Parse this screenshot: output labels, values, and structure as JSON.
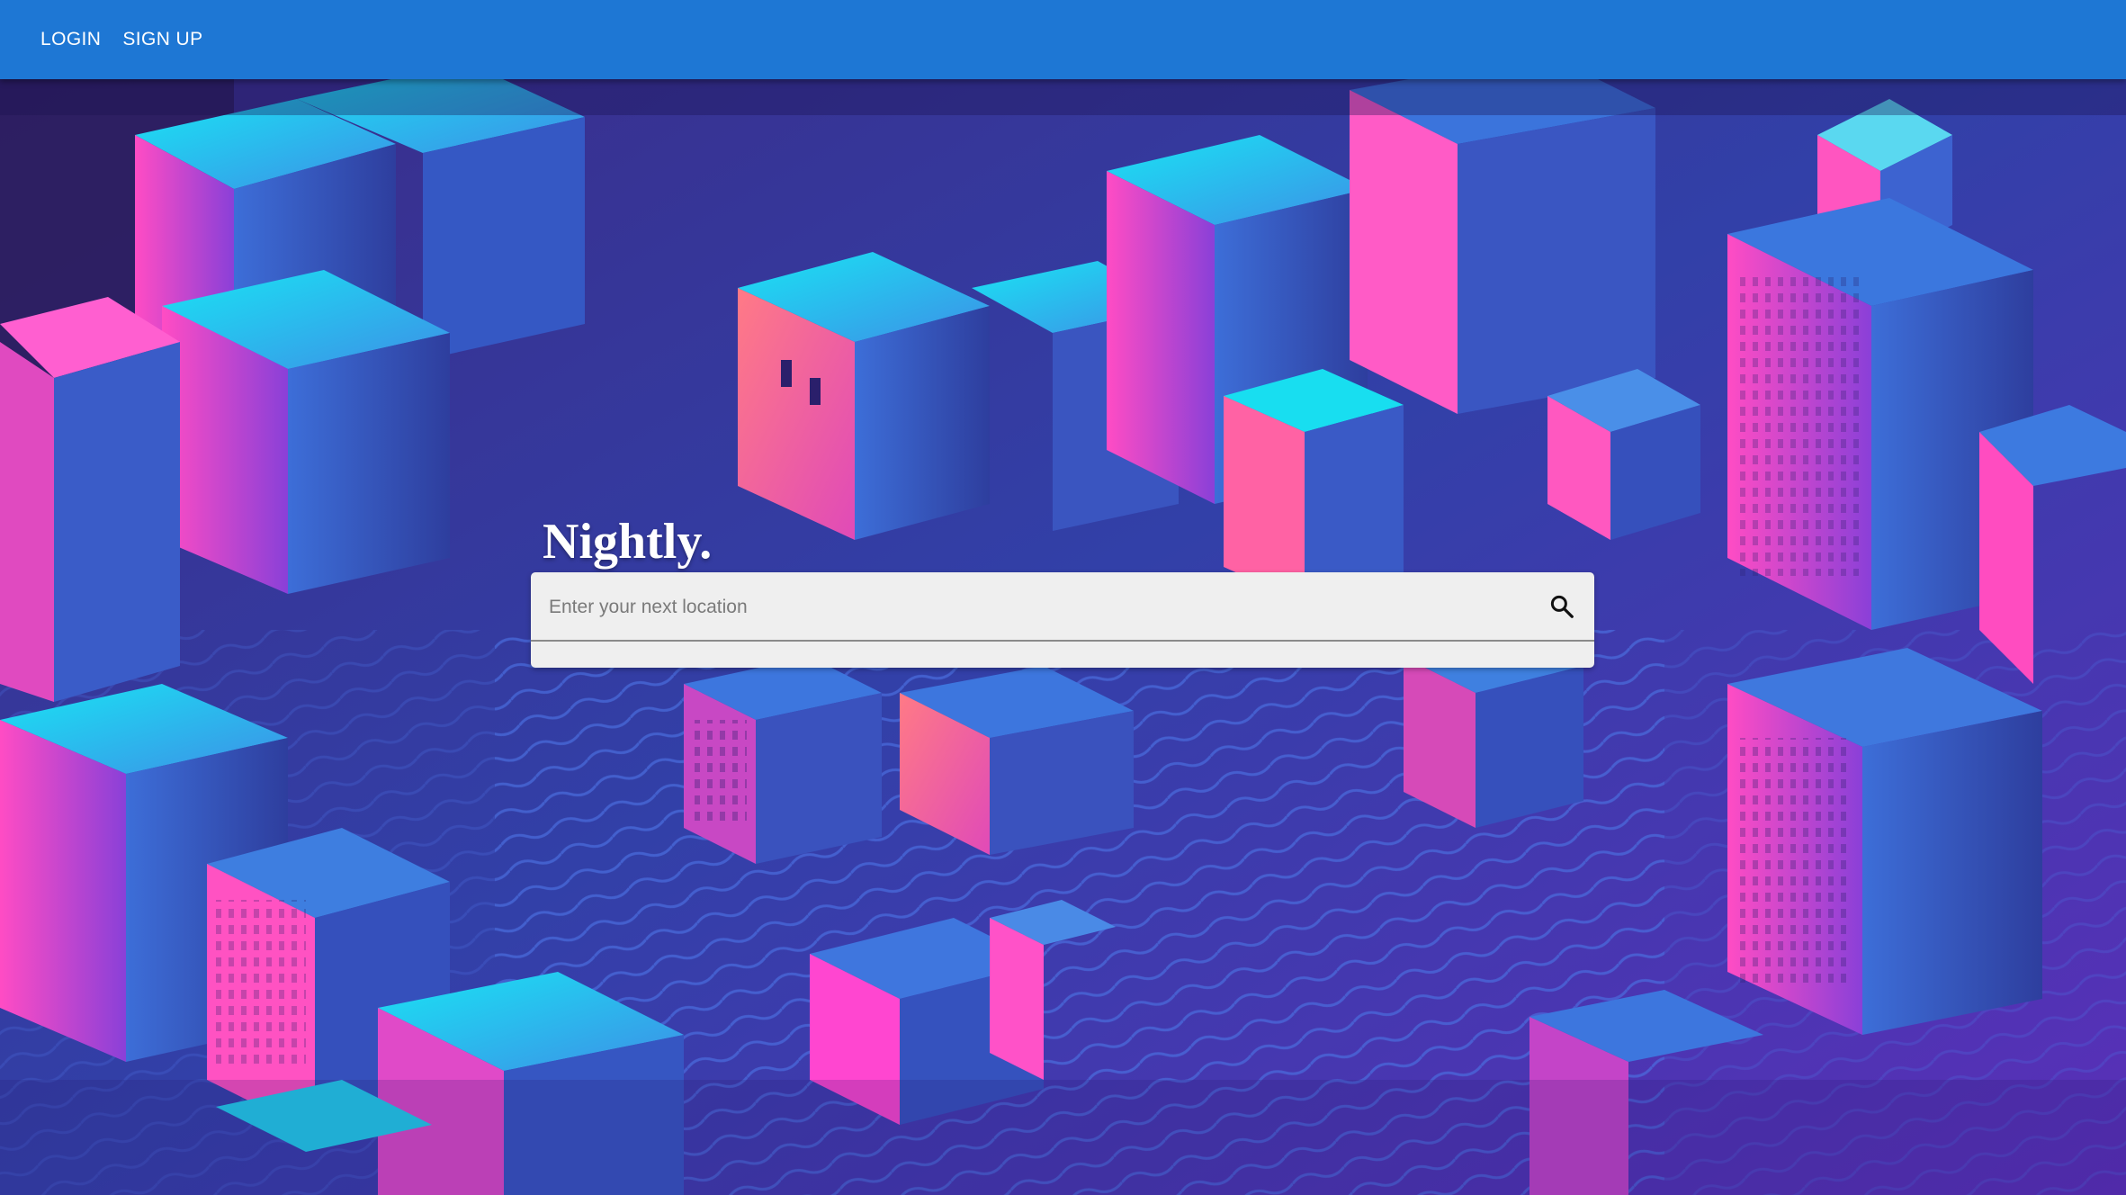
{
  "nav": {
    "login_label": "LOGIN",
    "signup_label": "SIGN UP"
  },
  "hero": {
    "brand_title": "Nightly.",
    "search": {
      "placeholder": "Enter your next location",
      "value": "",
      "icon": "search-icon"
    }
  },
  "background": {
    "description_icon": "city-illustration",
    "palette": {
      "deep": "#2b1f6b",
      "blue": "#3a6ad6",
      "cyan": "#16e0f2",
      "magenta": "#ff3fc8",
      "coral": "#ff6f85",
      "violet": "#7b3ad6"
    }
  },
  "colors": {
    "appbar": "#1e77d4",
    "search_bg": "#efefef"
  }
}
